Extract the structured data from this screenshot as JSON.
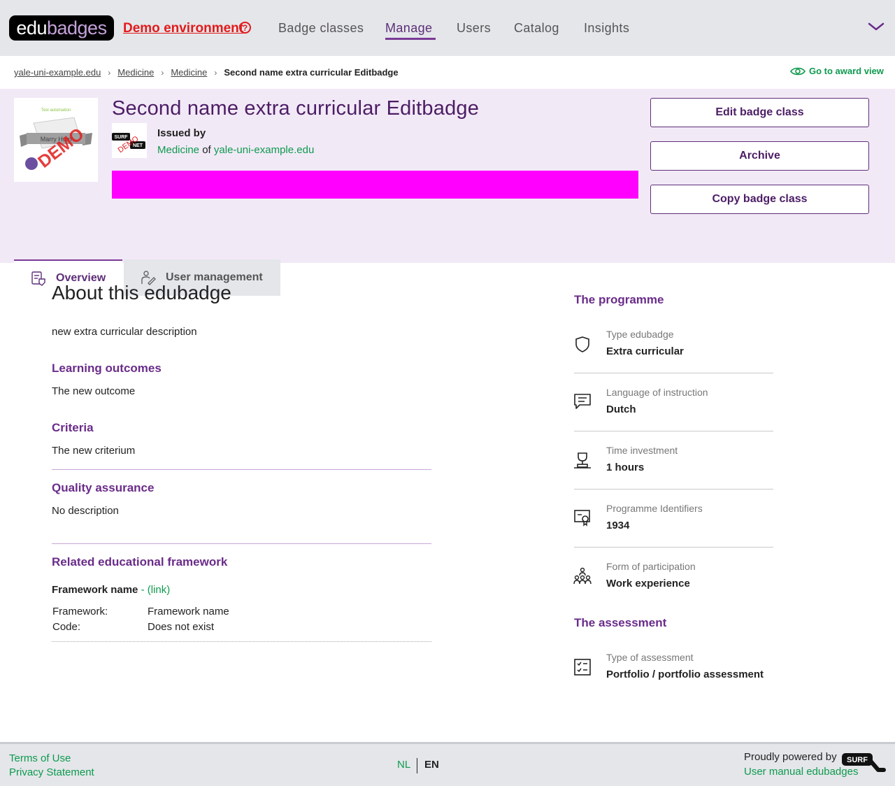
{
  "header": {
    "logo_edu": "edu",
    "logo_badges": "badges",
    "demo_env": "Demo environment",
    "nav": [
      "Badge classes",
      "Manage",
      "Users",
      "Catalog",
      "Insights"
    ],
    "active_nav": "Manage"
  },
  "breadcrumb": {
    "items": [
      "yale-uni-example.edu",
      "Medicine",
      "Medicine"
    ],
    "current": "Second name extra curricular Editbadge"
  },
  "award_view": "Go to award view",
  "badge": {
    "title": "Second name extra curricular Editbadge",
    "image_caption": "Test automation",
    "image_banner": "Marry Hum",
    "image_stamp": "DEMO",
    "issued_by_label": "Issued by",
    "issuer_faculty": "Medicine",
    "issuer_of": "of",
    "issuer_institution": "yale-uni-example.edu",
    "issuer_logo_text": "SURF",
    "issuer_logo_text2": "NET",
    "issuer_logo_stamp": "DEMO"
  },
  "actions": {
    "edit": "Edit badge class",
    "archive": "Archive",
    "copy": "Copy badge class"
  },
  "tabs": {
    "overview": "Overview",
    "users": "User management"
  },
  "about": {
    "title": "About this edubadge",
    "description": "new extra curricular description",
    "learning_outcomes_title": "Learning outcomes",
    "learning_outcomes": "The new outcome",
    "criteria_title": "Criteria",
    "criteria": "The new criterium",
    "quality_title": "Quality assurance",
    "quality": "No description",
    "framework_title": "Related educational framework",
    "framework_name": "Framework name",
    "framework_link": "(link)",
    "framework_label": "Framework:",
    "framework_value": "Framework name",
    "code_label": "Code:",
    "code_value": "Does not exist"
  },
  "programme": {
    "title": "The programme",
    "items": [
      {
        "label": "Type edubadge",
        "value": "Extra curricular",
        "icon": "shield-icon"
      },
      {
        "label": "Language of instruction",
        "value": "Dutch",
        "icon": "chat-icon"
      },
      {
        "label": "Time investment",
        "value": "1 hours",
        "icon": "trophy-icon"
      },
      {
        "label": "Programme Identifiers",
        "value": "1934",
        "icon": "certificate-icon"
      },
      {
        "label": "Form of participation",
        "value": "Work experience",
        "icon": "group-icon"
      }
    ]
  },
  "assessment": {
    "title": "The assessment",
    "label": "Type of assessment",
    "value": "Portfolio / portfolio assessment"
  },
  "footer": {
    "terms": "Terms of Use",
    "privacy": "Privacy Statement",
    "lang_nl": "NL",
    "lang_en": "EN",
    "powered": "Proudly powered by",
    "manual": "User manual edubadges",
    "surf_logo": "SURF"
  },
  "colors": {
    "brand_purple": "#5d2e78",
    "accent_green": "#0e9a4e",
    "demo_red": "#e21b1b",
    "hero_bg": "#f2e9f7",
    "magenta_bar": "#ff00ff"
  }
}
